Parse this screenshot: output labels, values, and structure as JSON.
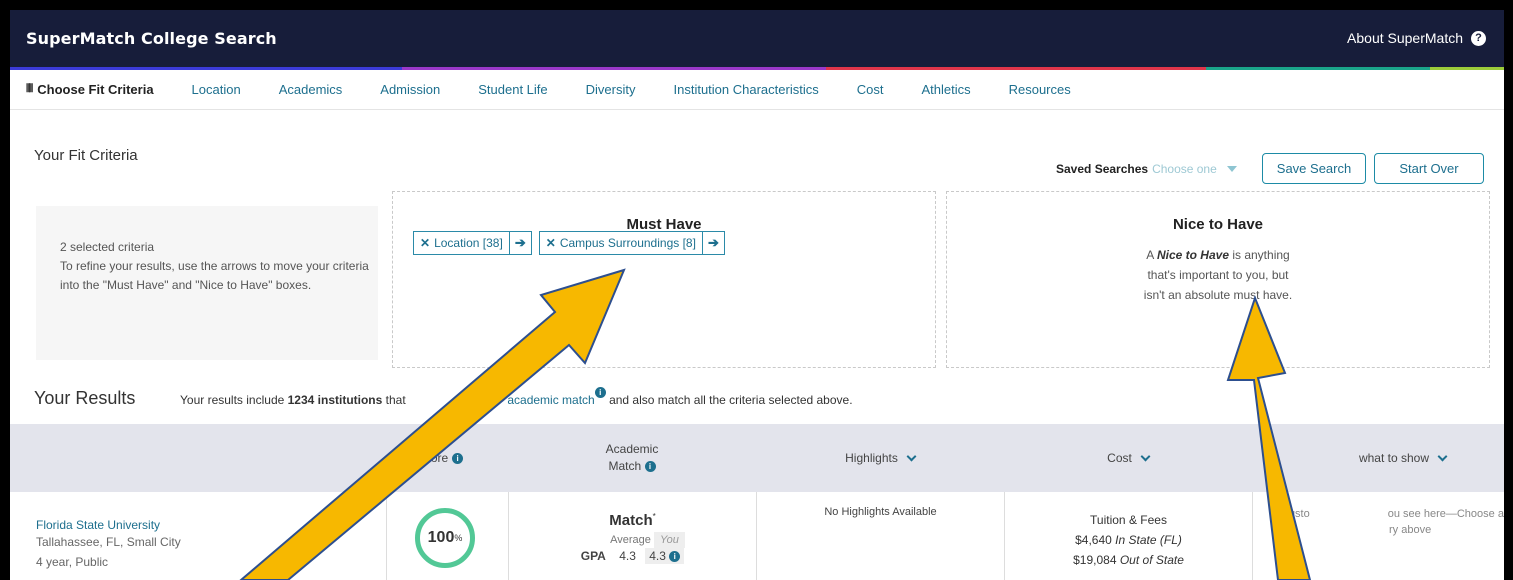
{
  "app": {
    "title": "SuperMatch College Search",
    "about": "About SuperMatch",
    "help_icon": "?"
  },
  "nav": {
    "active": "Choose Fit Criteria",
    "items": [
      "Location",
      "Academics",
      "Admission",
      "Student Life",
      "Diversity",
      "Institution Characteristics",
      "Cost",
      "Athletics",
      "Resources"
    ]
  },
  "fit": {
    "title": "Your Fit Criteria",
    "saved_label": "Saved Searches",
    "saved_placeholder": "Choose one",
    "save_button": "Save Search",
    "start_over_button": "Start Over",
    "selected_count": "2 selected criteria",
    "instructions": "To refine your results, use the arrows to move your criteria into the \"Must Have\" and \"Nice to Have\" boxes."
  },
  "must_have": {
    "title": "Must Have",
    "chips": [
      {
        "label": "Location [38]"
      },
      {
        "label": "Campus Surroundings [8]"
      }
    ]
  },
  "nice_to_have": {
    "title": "Nice to Have",
    "desc_em": "Nice to Have",
    "desc_pre": "A ",
    "desc_post": " is anything that's important to you, but isn't an absolute must have."
  },
  "results": {
    "title": "Your Results",
    "text_pre": "Your results include ",
    "count": "1234 institutions",
    "text_mid": " that",
    "link": "academic match",
    "text_post": " and also match all the criteria selected above."
  },
  "table": {
    "headers": {
      "score": "ore",
      "academic_match_1": "Academic",
      "academic_match_2": "Match",
      "highlights": "Highlights",
      "cost": "Cost",
      "show": "what to show"
    },
    "row": {
      "name": "Florida State University",
      "location": "Tallahassee, FL, Small City",
      "type": "4 year, Public",
      "score": "100",
      "score_unit": "%",
      "match": "Match",
      "match_star": "*",
      "average_label": "Average",
      "you_label": "You",
      "gpa_label": "GPA",
      "gpa_avg": "4.3",
      "gpa_you": "4.3",
      "highlights": "No Highlights Available",
      "tuition_label": "Tuition & Fees",
      "in_state_amount": "$4,640",
      "in_state_label": "In State (FL)",
      "out_state_amount": "$19,084",
      "out_state_label": "Out of State",
      "custom_1": "Custo",
      "custom_2": "ou see here—Choose a",
      "custom_3": "ry above"
    }
  },
  "colors": {
    "topbar": "#171d3a",
    "accent": "#1d6f8e",
    "score_ring": "#52c896",
    "arrow": "#f7b800",
    "arrow_outline": "#2d4f8f"
  }
}
